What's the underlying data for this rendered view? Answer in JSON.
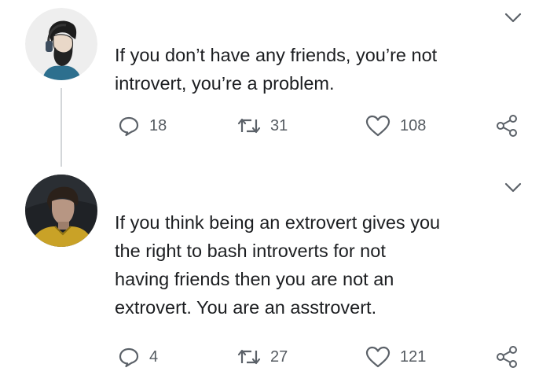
{
  "tweets": [
    {
      "text_lines": [
        "If you don’t have any friends, you’re not",
        "introvert, you’re a problem."
      ],
      "replies": "18",
      "retweets": "31",
      "likes": "108",
      "avatar_icon": "bearded-man-headphones-avatar"
    },
    {
      "text_lines": [
        "If you think being an extrovert gives you",
        "the right to bash introverts for not",
        "having friends then you are not an",
        "extrovert. You are an asstrovert."
      ],
      "replies": "4",
      "retweets": "27",
      "likes": "121",
      "avatar_icon": "young-man-yellow-jacket-avatar"
    }
  ],
  "icons": {
    "reply": "reply-icon",
    "retweet": "retweet-icon",
    "like": "heart-icon",
    "share": "share-icon",
    "more": "chevron-down-icon"
  },
  "colors": {
    "text": "#1c1e21",
    "icon": "#5b6168",
    "thread_line": "#d3d6d9"
  }
}
